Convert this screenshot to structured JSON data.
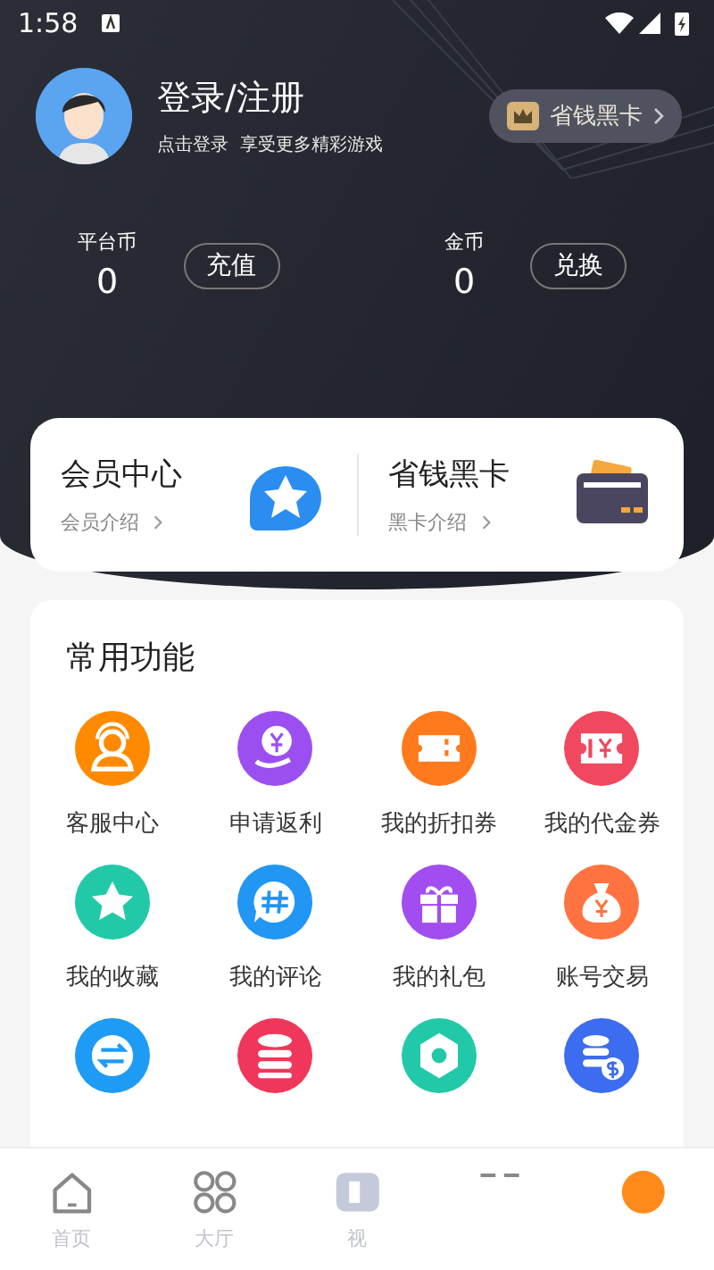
{
  "status_bar": {
    "time": "1:58"
  },
  "profile": {
    "name": "登录/注册",
    "subtitle": "点击登录  享受更多精彩游戏",
    "vip_button": "省钱黑卡"
  },
  "wallet": [
    {
      "label": "平台币",
      "value": "0",
      "button": "充值"
    },
    {
      "label": "金币",
      "value": "0",
      "button": "兑换"
    }
  ],
  "member_card": [
    {
      "kind": "member",
      "title": "会员中心",
      "link": "会员介绍"
    },
    {
      "kind": "blackcard",
      "title": "省钱黑卡",
      "link": "黑卡介绍"
    }
  ],
  "functions": {
    "title": "常用功能",
    "items": [
      {
        "kind": "support",
        "label": "客服中心",
        "color": "#ff8a00"
      },
      {
        "kind": "rebate",
        "label": "申请返利",
        "color": "#9b4ff0"
      },
      {
        "kind": "ticket",
        "label": "我的折扣券",
        "color": "#ff7a1c"
      },
      {
        "kind": "voucher",
        "label": "我的代金券",
        "color": "#f0485e"
      },
      {
        "kind": "star",
        "label": "我的收藏",
        "color": "#22c9a8"
      },
      {
        "kind": "comment",
        "label": "我的评论",
        "color": "#2196f3"
      },
      {
        "kind": "gift",
        "label": "我的礼包",
        "color": "#a24df0"
      },
      {
        "kind": "moneybag",
        "label": "账号交易",
        "color": "#ff7340"
      },
      {
        "kind": "swap",
        "color": "#1e9bf5"
      },
      {
        "kind": "coins",
        "color": "#f0365a"
      },
      {
        "kind": "settings",
        "color": "#22c9a8"
      },
      {
        "kind": "coinsdollar",
        "color": "#3c6cf0"
      }
    ]
  },
  "bottom_nav": [
    {
      "kind": "home",
      "label": "首页",
      "selected": false
    },
    {
      "kind": "hall",
      "label": "大厅",
      "selected": false
    },
    {
      "kind": "video",
      "label": "视",
      "selected": false
    },
    {
      "kind": "grid",
      "selected": false
    },
    {
      "kind": "mine",
      "selected": true
    }
  ]
}
